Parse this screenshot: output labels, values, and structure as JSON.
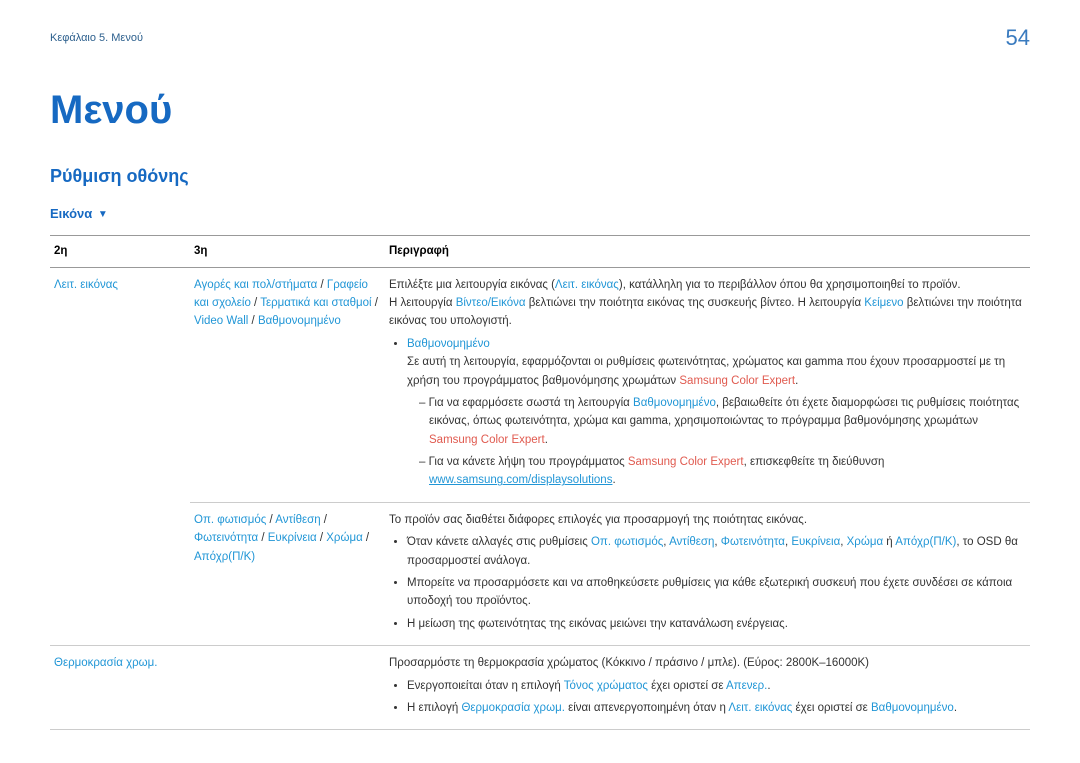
{
  "page_number": "54",
  "breadcrumb": "Κεφάλαιο 5. Μενού",
  "chapter_title": "Μενού",
  "section_title": "Ρύθμιση οθόνης",
  "subsection_label": "Εικόνα",
  "table": {
    "headers": {
      "c1": "2η",
      "c2": "3η",
      "c3": "Περιγραφή"
    },
    "row1": {
      "col1": "Λειτ. εικόνας",
      "c2_agores": "Αγορές και πολ/στήματα",
      "c2_grafeio": "Γραφείο και σχολείο",
      "c2_terminal": "Τερματικά και σταθμοί",
      "c2_videowall": "Video Wall",
      "c2_bathmo": "Βαθμονομημένο",
      "desc_intro_pre": "Επιλέξτε μια λειτουργία εικόνας (",
      "desc_intro_kw": "Λειτ. εικόνας",
      "desc_intro_post": "), κατάλληλη για το περιβάλλον όπου θα χρησιμοποιηθεί το προϊόν.",
      "desc_line2_pre": "Η λειτουργία ",
      "desc_line2_kw1": "Βίντεο/Εικόνα",
      "desc_line2_mid": " βελτιώνει την ποιότητα εικόνας της συσκευής βίντεο. Η λειτουργία ",
      "desc_line2_kw2": "Κείμενο",
      "desc_line2_post": " βελτιώνει την ποιότητα εικόνας του υπολογιστή.",
      "bullet1_label": "Βαθμονομημένο",
      "bullet1_body_pre": "Σε αυτή τη λειτουργία, εφαρμόζονται οι ρυθμίσεις φωτεινότητας, χρώματος και gamma που έχουν προσαρμοστεί με τη χρήση του προγράμματος βαθμονόμησης χρωμάτων ",
      "bullet1_body_kw": "Samsung Color Expert",
      "bullet1_body_post": ".",
      "dash1_pre": "Για να εφαρμόσετε σωστά τη λειτουργία ",
      "dash1_kw": "Βαθμονομημένο",
      "dash1_mid": ", βεβαιωθείτε ότι έχετε διαμορφώσει τις ρυθμίσεις ποιότητας εικόνας, όπως φωτεινότητα, χρώμα και gamma, χρησιμοποιώντας το πρόγραμμα βαθμονόμησης χρωμάτων ",
      "dash1_kw2": "Samsung Color Expert",
      "dash1_post": ".",
      "dash2_pre": "Για να κάνετε λήψη του προγράμματος ",
      "dash2_kw": "Samsung Color Expert",
      "dash2_mid": ", επισκεφθείτε τη διεύθυνση ",
      "dash2_link": "www.samsung.com/displaysolutions",
      "dash2_post": "."
    },
    "row2": {
      "c2_op": "Οπ. φωτισμός",
      "c2_antithesi": "Αντίθεση",
      "c2_foteinotita": "Φωτεινότητα",
      "c2_efkrineia": "Ευκρίνεια",
      "c2_xroma": "Χρώμα",
      "c2_apoxr": "Απόχρ(Π/Κ)",
      "desc_intro": "Το προϊόν σας διαθέτει διάφορες επιλογές για προσαρμογή της ποιότητας εικόνας.",
      "b1_pre": "Όταν κάνετε αλλαγές στις ρυθμίσεις ",
      "b1_kw1": "Οπ. φωτισμός",
      "b1_s1": ", ",
      "b1_kw2": "Αντίθεση",
      "b1_s2": ", ",
      "b1_kw3": "Φωτεινότητα",
      "b1_s3": ", ",
      "b1_kw4": "Ευκρίνεια",
      "b1_s4": ", ",
      "b1_kw5": "Χρώμα",
      "b1_s5": " ή ",
      "b1_kw6": "Απόχρ(Π/Κ)",
      "b1_post": ", το OSD θα προσαρμοστεί ανάλογα.",
      "b2": "Μπορείτε να προσαρμόσετε και να αποθηκεύσετε ρυθμίσεις για κάθε εξωτερική συσκευή που έχετε συνδέσει σε κάποια υποδοχή του προϊόντος.",
      "b3": "Η μείωση της φωτεινότητας της εικόνας μειώνει την κατανάλωση ενέργειας."
    },
    "row3": {
      "col1": "Θερμοκρασία χρωμ.",
      "desc_intro": "Προσαρμόστε τη θερμοκρασία χρώματος (Κόκκινο / πράσινο / μπλε). (Εύρος: 2800K–16000K)",
      "b1_pre": "Ενεργοποιείται όταν η επιλογή ",
      "b1_kw1": "Τόνος χρώματος",
      "b1_mid": " έχει οριστεί σε ",
      "b1_kw2": "Απενερ.",
      "b1_post": ".",
      "b2_pre": "Η επιλογή ",
      "b2_kw1": "Θερμοκρασία χρωμ.",
      "b2_mid": " είναι απενεργοποιημένη όταν η ",
      "b2_kw2": "Λειτ. εικόνας",
      "b2_mid2": " έχει οριστεί σε ",
      "b2_kw3": "Βαθμονομημένο",
      "b2_post": "."
    }
  }
}
